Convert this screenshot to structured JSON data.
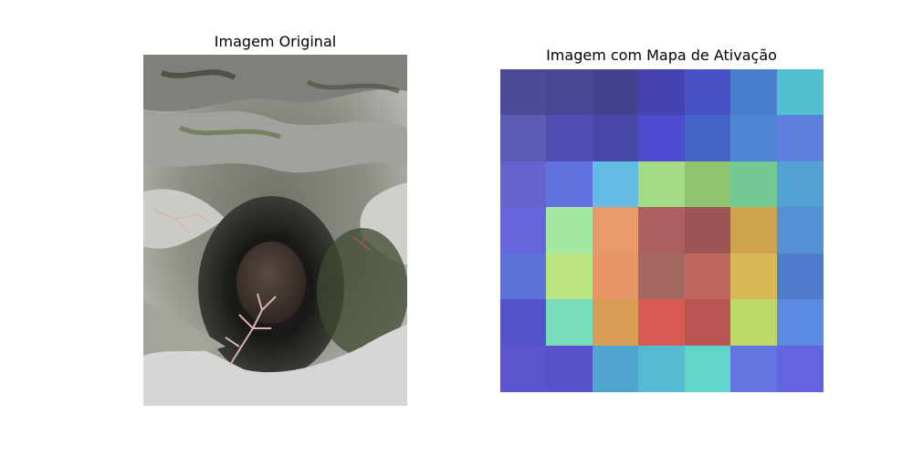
{
  "figure": {
    "left_title": "Imagem Original",
    "right_title": "Imagem com Mapa de Ativação"
  },
  "photo": {
    "subject": "rocky sinkhole pit seen from above with snow and bare twigs"
  },
  "activation_map": {
    "rows": 7,
    "cols": 7,
    "colors": [
      [
        "#4c4a99",
        "#4a4595",
        "#454191",
        "#4342b0",
        "#4753c6",
        "#4b7ecb",
        "#52bfd0"
      ],
      [
        "#5a5cb4",
        "#4f4db1",
        "#4848a8",
        "#4d4bcf",
        "#4663c6",
        "#4f84d3",
        "#5f81dd"
      ],
      [
        "#6464cc",
        "#6172df",
        "#63bce4",
        "#a3da84",
        "#8fc36e",
        "#72c991",
        "#53a0d3"
      ],
      [
        "#6565dd",
        "#a2e8a0",
        "#e89a68",
        "#ab5f5f",
        "#9b5555",
        "#cfa34f",
        "#5590d6"
      ],
      [
        "#5c74d8",
        "#bde483",
        "#e89568",
        "#a3685f",
        "#bf6862",
        "#d9b857",
        "#4f7ccb"
      ],
      [
        "#5353cc",
        "#77dcbb",
        "#d89e55",
        "#d95a54",
        "#b85656",
        "#bdd96a",
        "#5c8ae0"
      ],
      [
        "#5a55cf",
        "#5751cb",
        "#4fa5ce",
        "#57bad3",
        "#63d4cb",
        "#6474e0",
        "#6464e0"
      ]
    ]
  }
}
